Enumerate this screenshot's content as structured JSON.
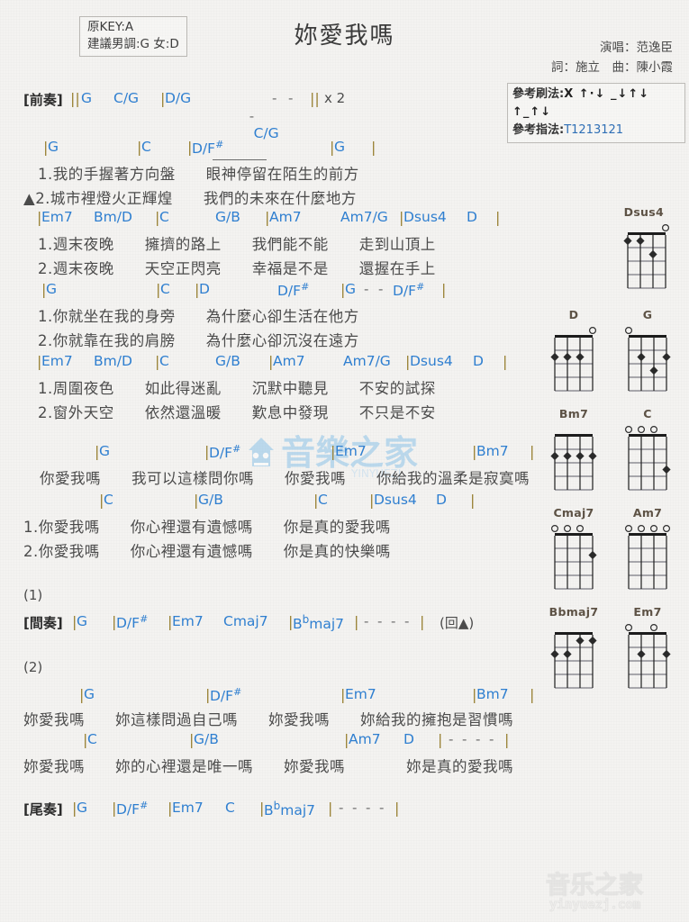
{
  "header": {
    "key_original": "原KEY:A",
    "key_suggest": "建議男調:G 女:D",
    "title": "妳愛我嗎",
    "singer": "演唱：范逸臣",
    "writer": "詞：施立　曲：陳小霞",
    "strum_label": "參考刷法:",
    "strum_value": "X ↑·↓ _↓↑↓ ↑_↑↓",
    "pick_label": "參考指法:",
    "pick_value": "T1213121"
  },
  "sections": {
    "intro_label": "[前奏]",
    "intro_chords": "||G   C/G   |D/G   -  C/G  -  -   || x 2",
    "interlude_label": "[間奏]",
    "outro_label": "[尾奏]",
    "marker1": "(1)",
    "marker2": "(2)",
    "repeat_note": "(回▲)"
  },
  "lines": [
    {
      "id": "verse1-a",
      "chords": [
        "|G",
        "|C",
        "|D/F#",
        "|G",
        "|"
      ],
      "lyrics": [
        "1.我的手握著方向盤　　眼神停留在陌生的前方",
        "▲2.城市裡燈火正輝煌　　我們的未來在什麼地方"
      ]
    },
    {
      "id": "verse1-b",
      "chords": [
        "|Em7",
        "Bm/D",
        "|C",
        "G/B",
        "|Am7",
        "Am7/G",
        "|Dsus4",
        "D",
        "|"
      ],
      "lyrics": [
        "1.週末夜晚　　擁擠的路上　　我們能不能　　走到山頂上",
        "2.週末夜晚　　天空正閃亮　　幸福是不是　　還握在手上"
      ]
    },
    {
      "id": "verse2-a",
      "chords": [
        "|G",
        "|C",
        "|D",
        "D/F#",
        "|G",
        "-",
        "-",
        "D/F#",
        "|"
      ],
      "lyrics": [
        "1.你就坐在我的身旁　　為什麼心卻生活在他方",
        "2.你就靠在我的肩膀　　為什麼心卻沉沒在遠方"
      ]
    },
    {
      "id": "verse2-b",
      "chords": [
        "|Em7",
        "Bm/D",
        "|C",
        "G/B",
        "|Am7",
        "Am7/G",
        "|Dsus4",
        "D",
        "|"
      ],
      "lyrics": [
        "1.周圍夜色　　如此得迷亂　　沉默中聽見　　不安的試探",
        "2.窗外天空　　依然還溫暖　　歎息中發現　　不只是不安"
      ]
    },
    {
      "id": "chorus-a",
      "chords": [
        "|G",
        "|D/F#",
        "|Em7",
        "|Bm7",
        "|"
      ],
      "lyrics": [
        "你愛我嗎　　我可以這樣問你嗎　　你愛我嗎　　你給我的溫柔是寂寞嗎"
      ]
    },
    {
      "id": "chorus-b",
      "chords": [
        "|C",
        "|G/B",
        "|C",
        "|Dsus4",
        "D",
        "|"
      ],
      "lyrics": [
        "1.你愛我嗎　　你心裡還有遺憾嗎　　你是真的愛我嗎",
        "2.你愛我嗎　　你心裡還有遺憾嗎　　你是真的快樂嗎"
      ]
    },
    {
      "id": "interlude",
      "chords": [
        "|G",
        "|D/F#",
        "|Em7",
        "Cmaj7",
        "|Bbmaj7",
        "|",
        "-",
        "-",
        "-",
        "-",
        "|"
      ],
      "lyrics": []
    },
    {
      "id": "chorus2-a",
      "chords": [
        "|G",
        "|D/F#",
        "|Em7",
        "|Bm7",
        "|"
      ],
      "lyrics": [
        "妳愛我嗎　　妳這樣問過自己嗎　　妳愛我嗎　　妳給我的擁抱是習慣嗎"
      ]
    },
    {
      "id": "chorus2-b",
      "chords": [
        "|C",
        "|G/B",
        "|Am7",
        "D",
        "|",
        "-",
        "-",
        "-",
        "-",
        "|"
      ],
      "lyrics": [
        "妳愛我嗎　　妳的心裡還是唯一嗎　　妳愛我嗎　　　　妳是真的愛我嗎"
      ]
    },
    {
      "id": "outro",
      "chords": [
        "|G",
        "|D/F#",
        "|Em7",
        "C",
        "|Bbmaj7",
        "|",
        "-",
        "-",
        "-",
        "-",
        "|"
      ],
      "lyrics": []
    }
  ],
  "chord_diagrams": [
    {
      "name": "Dsus4",
      "open": [
        0,
        0,
        0,
        1
      ],
      "dots": [
        [
          1,
          1
        ],
        [
          1,
          2
        ],
        [
          2,
          3
        ]
      ]
    },
    {
      "name": "D",
      "open": [
        0,
        0,
        0,
        1
      ],
      "dots": [
        [
          2,
          1
        ],
        [
          2,
          2
        ],
        [
          2,
          3
        ]
      ]
    },
    {
      "name": "G",
      "open": [
        1,
        0,
        0,
        0
      ],
      "dots": [
        [
          2,
          2
        ],
        [
          2,
          4
        ],
        [
          3,
          3
        ]
      ]
    },
    {
      "name": "Bm7",
      "open": [
        0,
        0,
        0,
        0
      ],
      "dots": [
        [
          2,
          1
        ],
        [
          2,
          2
        ],
        [
          2,
          3
        ],
        [
          2,
          4
        ]
      ]
    },
    {
      "name": "C",
      "open": [
        1,
        1,
        1,
        0
      ],
      "dots": [
        [
          3,
          4
        ]
      ]
    },
    {
      "name": "Cmaj7",
      "open": [
        1,
        1,
        1,
        0
      ],
      "dots": [
        [
          2,
          4
        ]
      ]
    },
    {
      "name": "Am7",
      "open": [
        1,
        1,
        1,
        1
      ],
      "dots": []
    },
    {
      "name": "Bbmaj7",
      "open": [
        0,
        0,
        0,
        0
      ],
      "dots": [
        [
          2,
          1
        ],
        [
          2,
          2
        ],
        [
          1,
          3
        ],
        [
          1,
          4
        ]
      ]
    },
    {
      "name": "Em7",
      "open": [
        1,
        0,
        1,
        0
      ],
      "dots": [
        [
          2,
          2
        ],
        [
          2,
          4
        ]
      ]
    }
  ],
  "watermark": {
    "center_text": "音樂之家",
    "center_sub": "YINYUEZJ",
    "footer_text": "音乐之家",
    "footer_url": "yinyuezj.com"
  },
  "colors": {
    "chord": "#2f7fd0",
    "bar": "#9a8236",
    "lyric": "#4b4b4b",
    "paper": "#f4f3f1",
    "diagram": "#5d5245"
  }
}
